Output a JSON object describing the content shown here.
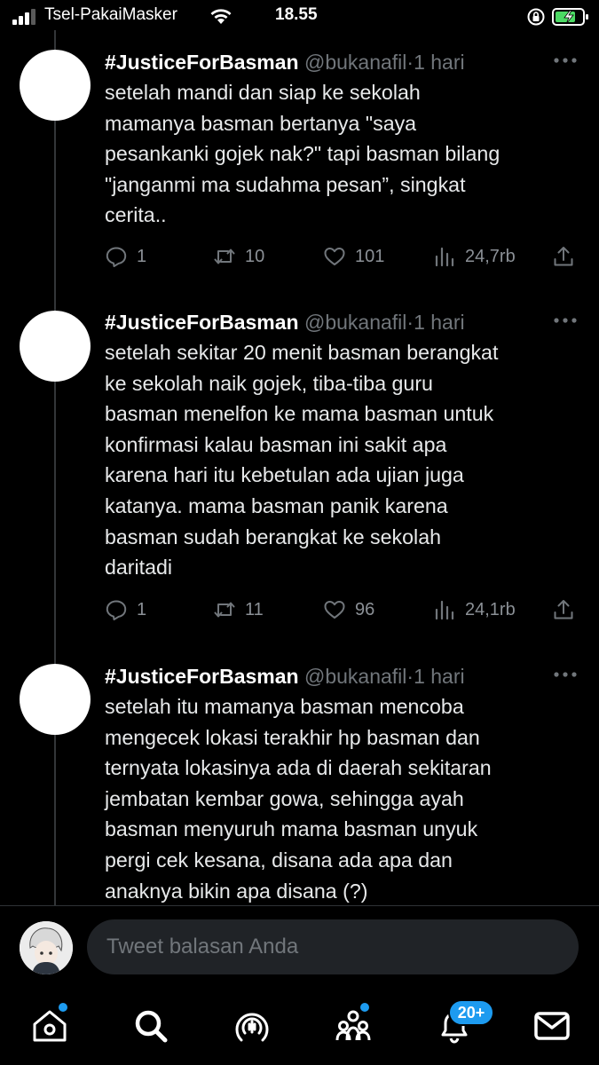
{
  "status_bar": {
    "carrier": "Tsel-PakaiMasker",
    "time": "18.55"
  },
  "tweets": [
    {
      "name": "#JusticeForBasman",
      "handle": "@bukanafil",
      "dot": "·",
      "time": "1 hari",
      "text": "setelah mandi dan siap ke sekolah\nmamanya basman bertanya \"saya\npesankanki gojek nak?\" tapi basman bilang\n\"janganmi ma sudahma pesan”, singkat\ncerita..",
      "replies": "1",
      "retweets": "10",
      "likes": "101",
      "views": "24,7rb"
    },
    {
      "name": "#JusticeForBasman",
      "handle": "@bukanafil",
      "dot": "·",
      "time": "1 hari",
      "text": "setelah sekitar 20 menit basman berangkat\nke sekolah naik gojek, tiba-tiba guru\nbasman menelfon ke mama basman untuk\nkonfirmasi kalau basman ini sakit apa\nkarena hari itu kebetulan ada ujian juga\nkatanya. mama basman panik karena\nbasman sudah berangkat ke sekolah\ndaritadi",
      "replies": "1",
      "retweets": "11",
      "likes": "96",
      "views": "24,1rb"
    },
    {
      "name": "#JusticeForBasman",
      "handle": "@bukanafil",
      "dot": "·",
      "time": "1 hari",
      "text": "setelah itu mamanya basman mencoba\nmengecek lokasi terakhir hp basman dan\nternyata lokasinya ada di daerah sekitaran\njembatan kembar gowa, sehingga ayah\nbasman menyuruh mama basman unyuk\npergi cek kesana, disana ada apa dan\nanaknya bikin apa disana (?)"
    }
  ],
  "reply_bar": {
    "placeholder": "Tweet balasan Anda"
  },
  "bottom_nav": {
    "items": [
      "home-icon",
      "search-icon",
      "spaces-icon",
      "communities-icon",
      "notifications-icon",
      "messages-icon"
    ],
    "notification_badge": "20+"
  },
  "colors": {
    "background": "#000000",
    "text": "#e7e9ea",
    "muted": "#71767b",
    "accent": "#1d9bf0",
    "battery": "#4cd964"
  }
}
